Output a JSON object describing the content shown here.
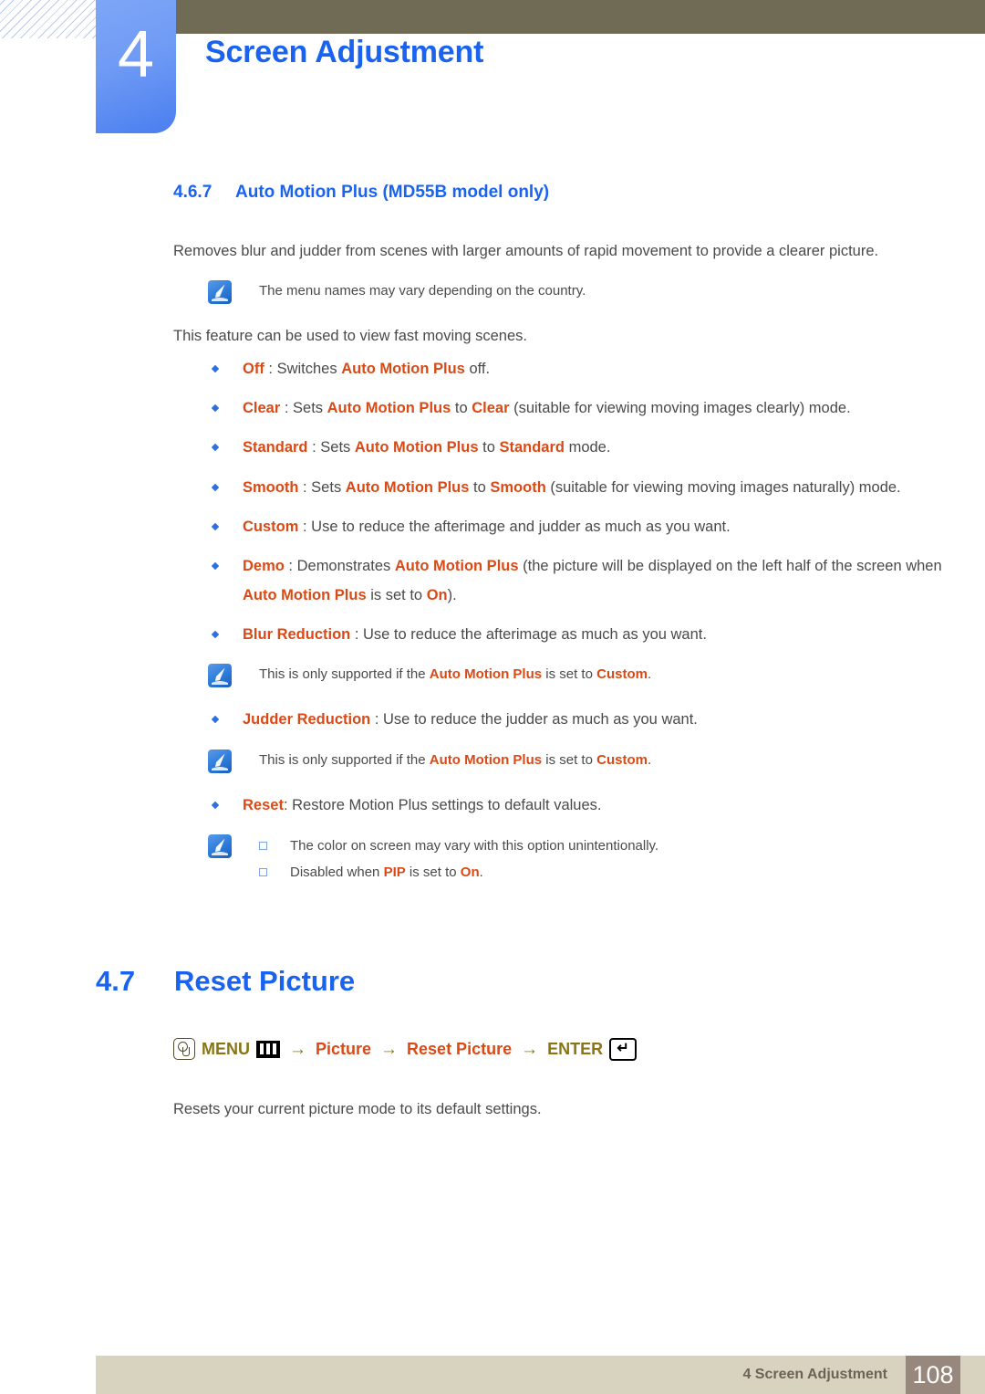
{
  "header": {
    "chapter_number": "4",
    "chapter_title": "Screen Adjustment",
    "badge_color": "#6f9bf5",
    "bar_color": "#706b55",
    "title_color": "#1a63f0"
  },
  "section": {
    "number": "4.6.7",
    "title": "Auto Motion Plus (MD55B model only)",
    "intro": "Removes blur and judder from scenes with larger amounts of rapid movement to provide a clearer picture.",
    "note_1": "The menu names may vary depending on the country.",
    "after_note": "This feature can be used to view fast moving scenes.",
    "bullets": [
      {
        "id": "off",
        "parts": [
          {
            "t": "Off",
            "k": true
          },
          {
            "t": " : Switches ",
            "k": false
          },
          {
            "t": "Auto Motion Plus",
            "k": true
          },
          {
            "t": " off.",
            "k": false
          }
        ]
      },
      {
        "id": "clear",
        "parts": [
          {
            "t": "Clear",
            "k": true
          },
          {
            "t": " : Sets ",
            "k": false
          },
          {
            "t": "Auto Motion Plus",
            "k": true
          },
          {
            "t": " to ",
            "k": false
          },
          {
            "t": "Clear",
            "k": true
          },
          {
            "t": " (suitable for viewing moving images clearly) mode.",
            "k": false
          }
        ]
      },
      {
        "id": "standard",
        "parts": [
          {
            "t": "Standard",
            "k": true
          },
          {
            "t": " : Sets ",
            "k": false
          },
          {
            "t": "Auto Motion Plus",
            "k": true
          },
          {
            "t": " to ",
            "k": false
          },
          {
            "t": "Standard",
            "k": true
          },
          {
            "t": " mode.",
            "k": false
          }
        ]
      },
      {
        "id": "smooth",
        "parts": [
          {
            "t": "Smooth",
            "k": true
          },
          {
            "t": " : Sets ",
            "k": false
          },
          {
            "t": "Auto Motion Plus",
            "k": true
          },
          {
            "t": " to ",
            "k": false
          },
          {
            "t": "Smooth",
            "k": true
          },
          {
            "t": " (suitable for viewing moving images naturally) mode.",
            "k": false
          }
        ]
      },
      {
        "id": "custom",
        "parts": [
          {
            "t": "Custom",
            "k": true
          },
          {
            "t": " : Use to reduce the afterimage and judder as much as you want.",
            "k": false
          }
        ]
      },
      {
        "id": "demo",
        "parts": [
          {
            "t": "Demo",
            "k": true
          },
          {
            "t": " : Demonstrates ",
            "k": false
          },
          {
            "t": "Auto Motion Plus",
            "k": true
          },
          {
            "t": " (the picture will be displayed on the left half of the screen when ",
            "k": false
          },
          {
            "t": "Auto Motion Plus",
            "k": true
          },
          {
            "t": " is set to ",
            "k": false
          },
          {
            "t": "On",
            "k": true
          },
          {
            "t": ").",
            "k": false
          }
        ]
      },
      {
        "id": "blur-reduction",
        "parts": [
          {
            "t": "Blur Reduction",
            "k": true
          },
          {
            "t": " : Use to reduce the afterimage as much as you want.",
            "k": false
          }
        ]
      },
      {
        "id": "judder-reduction",
        "parts": [
          {
            "t": "Judder Reduction",
            "k": true
          },
          {
            "t": " : Use to reduce the judder as much as you want.",
            "k": false
          }
        ]
      },
      {
        "id": "reset",
        "parts": [
          {
            "t": "Reset",
            "k": true
          },
          {
            "t": ": Restore Motion Plus settings to default values.",
            "k": false
          }
        ]
      }
    ],
    "note_blur": [
      {
        "t": "This is only supported if the ",
        "k": false
      },
      {
        "t": "Auto Motion Plus",
        "k": true
      },
      {
        "t": " is set to ",
        "k": false
      },
      {
        "t": "Custom",
        "k": true
      },
      {
        "t": ".",
        "k": false
      }
    ],
    "note_judder": [
      {
        "t": "This is only supported if the ",
        "k": false
      },
      {
        "t": "Auto Motion Plus",
        "k": true
      },
      {
        "t": " is set to ",
        "k": false
      },
      {
        "t": "Custom",
        "k": true
      },
      {
        "t": ".",
        "k": false
      }
    ],
    "note_reset_items": [
      [
        {
          "t": "The color on screen may vary with this option unintentionally.",
          "k": false
        }
      ],
      [
        {
          "t": "Disabled when ",
          "k": false
        },
        {
          "t": "PIP",
          "k": true
        },
        {
          "t": " is set to ",
          "k": false
        },
        {
          "t": "On",
          "k": true
        },
        {
          "t": ".",
          "k": false
        }
      ]
    ]
  },
  "section2": {
    "number": "4.7",
    "title": "Reset Picture",
    "menu_path": {
      "hand_icon": "hand-press-icon",
      "menu_label": "MENU",
      "menu_bars_icon": "menu-bars-icon",
      "arrow": "→",
      "step_picture": "Picture",
      "step_reset_picture": "Reset Picture",
      "enter_label": "ENTER",
      "enter_icon": "enter-key-icon"
    },
    "description": "Resets your current picture mode to its default settings."
  },
  "footer": {
    "label": "4 Screen Adjustment",
    "page_number": "108",
    "bar_color": "#d8d3bf",
    "page_box_color": "#97877c"
  },
  "colors": {
    "accent_blue": "#1a63f0",
    "key_orange": "#d94a16",
    "olive": "#8a7513"
  }
}
